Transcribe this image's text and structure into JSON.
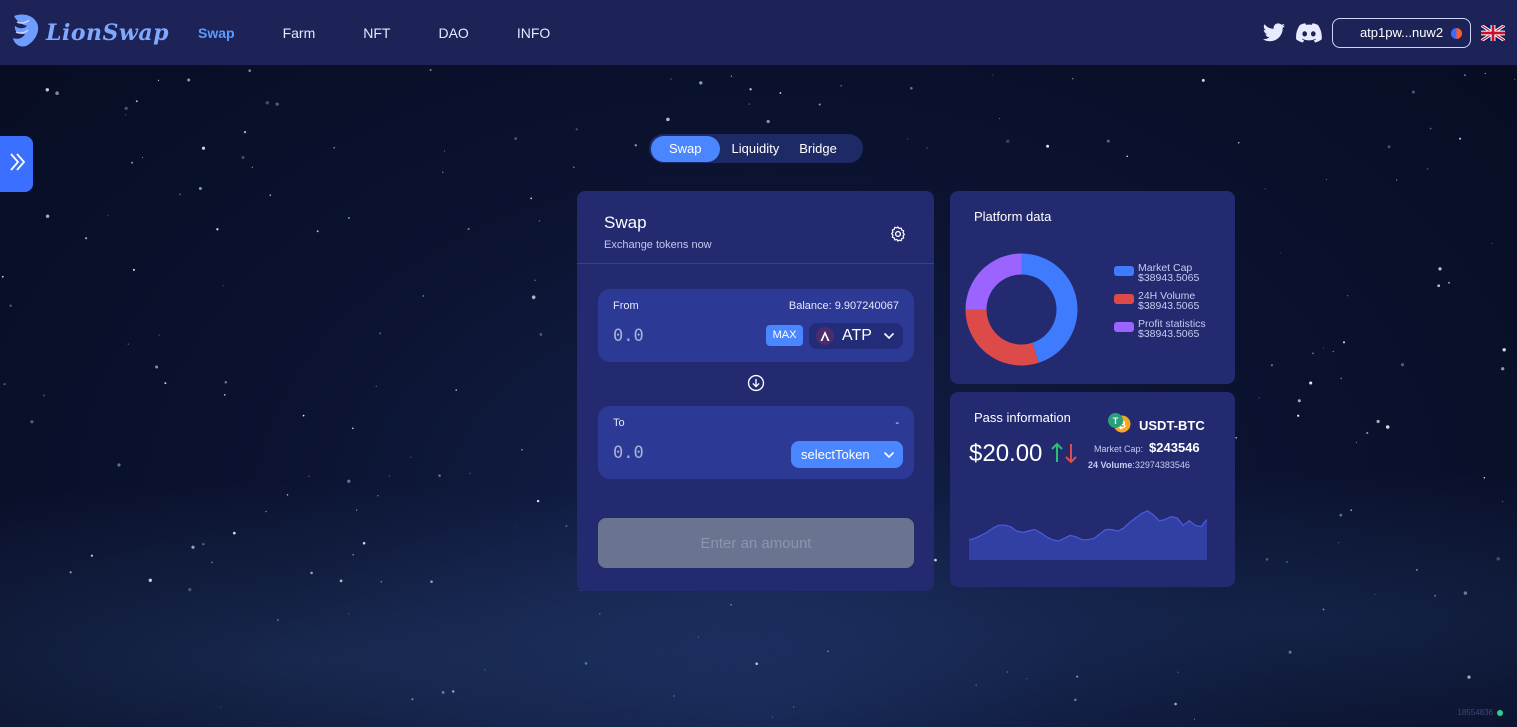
{
  "header": {
    "logo_text": "LionSwap",
    "nav": [
      "Swap",
      "Farm",
      "NFT",
      "DAO",
      "INFO"
    ],
    "active_nav": "Swap",
    "wallet_address": "atp1pw...nuw2"
  },
  "tabs": [
    "Swap",
    "Liquidity",
    "Bridge"
  ],
  "active_tab": "Swap",
  "swap": {
    "title": "Swap",
    "subtitle": "Exchange tokens now",
    "from": {
      "label": "From",
      "balance": "Balance: 9.907240067",
      "placeholder": "0.0",
      "max_label": "MAX",
      "token": "ATP"
    },
    "to": {
      "label": "To",
      "balance": "-",
      "placeholder": "0.0",
      "select_label": "selectToken"
    },
    "action_label": "Enter an amount"
  },
  "platform": {
    "title": "Platform data",
    "legend": [
      {
        "name": "Market Cap",
        "value": "$38943.5065",
        "color": "#3f7bff"
      },
      {
        "name": "24H Volume",
        "value": "$38943.5065",
        "color": "#dc4a4a"
      },
      {
        "name": "Profit statistics",
        "value": "$38943.5065",
        "color": "#9c64ff"
      }
    ]
  },
  "chart_data": [
    {
      "type": "pie",
      "categories": [
        "Market Cap",
        "24H Volume",
        "Profit statistics"
      ],
      "values": [
        45,
        30,
        25
      ]
    },
    {
      "type": "area",
      "x": [
        0,
        1,
        2,
        3,
        4,
        5,
        6,
        7,
        8,
        9,
        10,
        11,
        12,
        13,
        14,
        15,
        16,
        17,
        18,
        19,
        20,
        21,
        22,
        23,
        24,
        25,
        26,
        27,
        28,
        29,
        30,
        31,
        32,
        33,
        34,
        35,
        36,
        37,
        38,
        39,
        40
      ],
      "values": [
        14,
        15,
        17,
        19,
        22,
        24,
        24,
        23,
        20,
        19,
        20,
        21,
        19,
        16,
        14,
        13,
        15,
        17,
        16,
        14,
        14,
        15,
        18,
        21,
        21,
        20,
        22,
        26,
        29,
        32,
        34,
        31,
        27,
        28,
        30,
        29,
        24,
        27,
        24,
        23,
        28
      ],
      "ylim": [
        0,
        40
      ]
    }
  ],
  "pass": {
    "title": "Pass information",
    "pair": "USDT-BTC",
    "price": "$20.00",
    "market_cap_label": "Market Cap:",
    "market_cap_value": "$243546",
    "volume_label": "24 Volume",
    "volume_value": ":32974383546"
  },
  "build_id": "18554836",
  "colors": {
    "accent": "#4a86ff",
    "header_bg": "#1d2356",
    "card_bg": "#232a70",
    "up": "#2fbf71",
    "down": "#e24b4b"
  }
}
